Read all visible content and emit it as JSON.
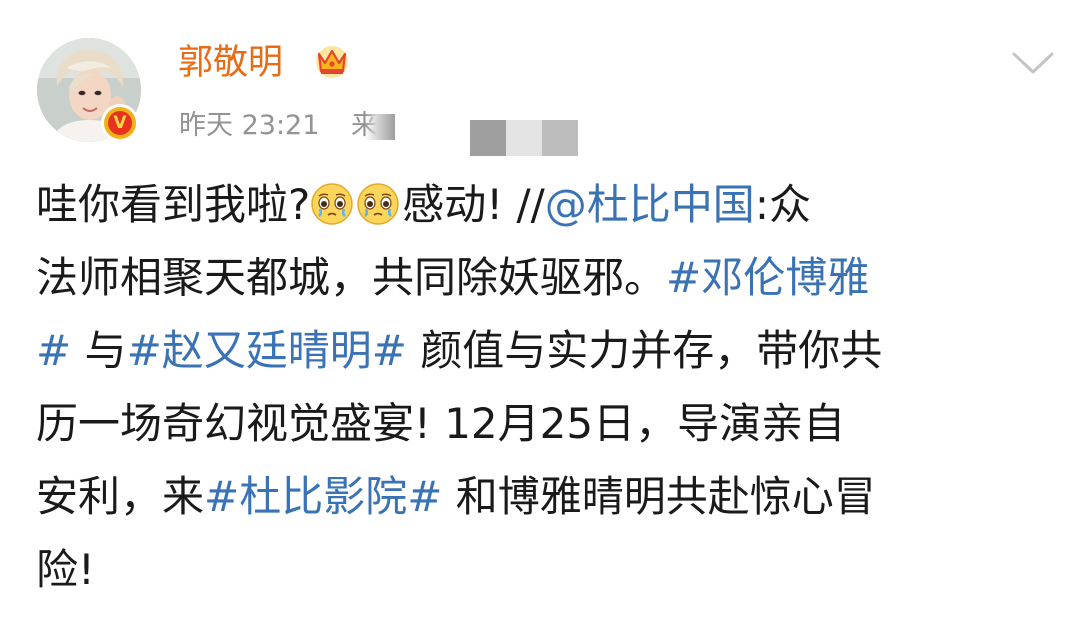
{
  "author": {
    "name": "郭敬明",
    "verified_mark": "V",
    "crown_icon": "crown-icon",
    "avatar_icon": "avatar-photo"
  },
  "meta": {
    "time": "昨天 23:21",
    "source_prefix": "来"
  },
  "menu": {
    "chevron_icon": "chevron-down-icon"
  },
  "post": {
    "line1": {
      "t1": "哇你看到我啦?",
      "t2": "感动! //",
      "mention": "@杜比中国",
      "t3": ":众"
    },
    "line2": {
      "t1": "法师相聚天都城，共同除妖驱邪。",
      "tag_a": "#邓伦博雅"
    },
    "line3": {
      "tag_a_end": "#",
      "t1": " 与",
      "tag_b": "#赵又廷晴明#",
      "t2": " 颜值与实力并存，带你共"
    },
    "line4": {
      "t1": "历一场奇幻视觉盛宴! 12月25日，导演亲自"
    },
    "line5": {
      "t1": "安利，来",
      "tag_c": "#杜比影院#",
      "t2": " 和博雅晴明共赴惊心冒"
    },
    "line6": {
      "t1": "险!"
    },
    "emoji_name": "tearful-pleading-emoji"
  },
  "colors": {
    "username": "#e86b16",
    "link": "#3a73b5",
    "meta": "#939393",
    "text": "#1a1a1a"
  }
}
